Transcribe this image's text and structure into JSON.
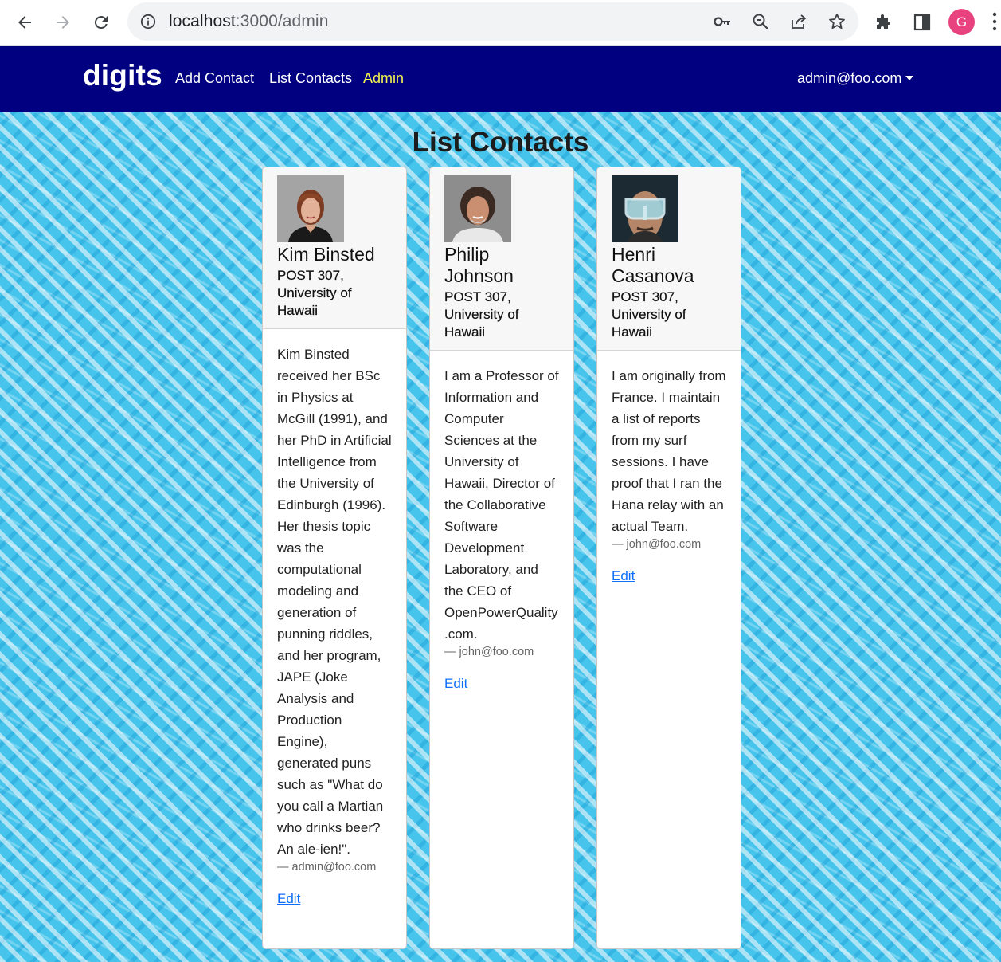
{
  "browser": {
    "url_host": "localhost",
    "url_rest": ":3000/admin",
    "profile_initial": "G"
  },
  "navbar": {
    "brand": "digits",
    "links": [
      {
        "label": "Add Contact",
        "active": false
      },
      {
        "label": "List Contacts",
        "active": false
      },
      {
        "label": "Admin",
        "active": true
      }
    ],
    "user": "admin@foo.com",
    "active_color": "#f5f552",
    "bg_color": "#000080"
  },
  "page": {
    "title": "List Contacts"
  },
  "contacts": [
    {
      "name": "Kim Binsted",
      "address": "POST 307, University of Hawaii",
      "description": "Kim Binsted received her BSc in Physics at McGill (1991), and her PhD in Artificial Intelligence from the University of Edinburgh (1996). Her thesis topic was the computational modeling and generation of punning riddles, and her program, JAPE (Joke Analysis and Production Engine), generated puns such as \"What do you call a Martian who drinks beer? An ale-ien!\".",
      "owner": "— admin@foo.com",
      "edit_label": "Edit"
    },
    {
      "name": "Philip Johnson",
      "address": "POST 307, University of Hawaii",
      "description": "I am a Professor of Information and Computer Sciences at the University of Hawaii, Director of the Collaborative Software Development Laboratory, and the CEO of OpenPowerQuality.com.",
      "owner": "— john@foo.com",
      "edit_label": "Edit"
    },
    {
      "name": "Henri Casanova",
      "address": "POST 307, University of Hawaii",
      "description": "I am originally from France. I maintain a list of reports from my surf sessions. I have proof that I ran the Hana relay with an actual Team.",
      "owner": "— john@foo.com",
      "edit_label": "Edit"
    }
  ]
}
